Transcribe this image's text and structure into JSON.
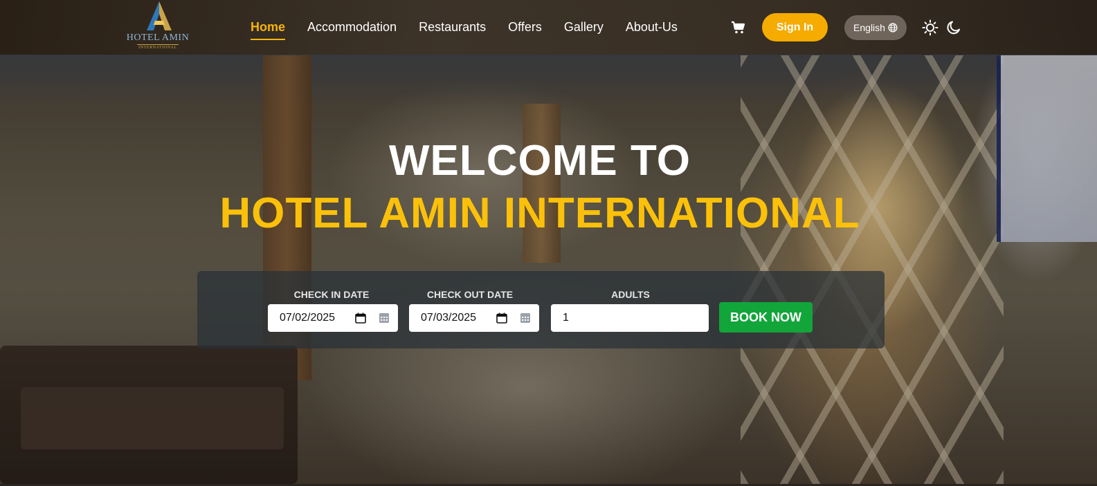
{
  "brand": {
    "name": "HOTEL AMIN",
    "subtitle": "INTERNATIONAL"
  },
  "nav": {
    "items": [
      {
        "label": "Home",
        "active": true
      },
      {
        "label": "Accommodation",
        "active": false
      },
      {
        "label": "Restaurants",
        "active": false
      },
      {
        "label": "Offers",
        "active": false
      },
      {
        "label": "Gallery",
        "active": false
      },
      {
        "label": "About-Us",
        "active": false
      }
    ],
    "cart_icon": "cart-icon",
    "signin_label": "Sign In",
    "language_label": "English",
    "language_icon": "globe-icon",
    "light_theme_icon": "sun-icon",
    "dark_theme_icon": "moon-icon"
  },
  "hero": {
    "headline_line1": "WELCOME TO",
    "headline_line2": "HOTEL AMIN INTERNATIONAL"
  },
  "booking": {
    "check_in": {
      "label": "CHECK IN DATE",
      "value": "07/02/2025"
    },
    "check_out": {
      "label": "CHECK OUT DATE",
      "value": "07/03/2025"
    },
    "adults": {
      "label": "ADULTS",
      "value": "1"
    },
    "book_label": "BOOK NOW"
  },
  "colors": {
    "accent": "#f5ab00",
    "headline_accent": "#fbc10a",
    "book_button": "#12a53a"
  }
}
